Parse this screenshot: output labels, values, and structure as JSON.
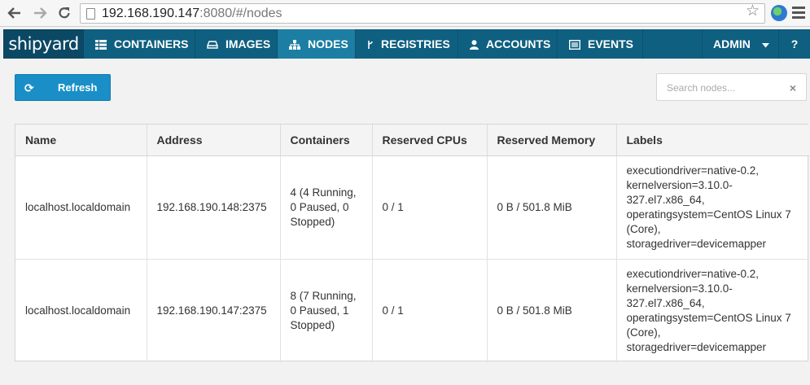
{
  "browser": {
    "url_host": "192.168.190.147",
    "url_rest": ":8080/#/nodes"
  },
  "nav": {
    "brand": "shipyard",
    "items": [
      {
        "label": "CONTAINERS",
        "icon": "grid-icon"
      },
      {
        "label": "IMAGES",
        "icon": "drive-icon"
      },
      {
        "label": "NODES",
        "icon": "sitemap-icon"
      },
      {
        "label": "REGISTRIES",
        "icon": "code-fork-icon"
      },
      {
        "label": "ACCOUNTS",
        "icon": "user-icon"
      },
      {
        "label": "EVENTS",
        "icon": "list-icon"
      }
    ],
    "active": "NODES",
    "user": "ADMIN",
    "help": "?"
  },
  "toolbar": {
    "refresh_label": "Refresh",
    "search_placeholder": "Search nodes..."
  },
  "table": {
    "headers": [
      "Name",
      "Address",
      "Containers",
      "Reserved CPUs",
      "Reserved Memory",
      "Labels"
    ],
    "rows": [
      {
        "name": "localhost.localdomain",
        "address": "192.168.190.148:2375",
        "containers": "4 (4 Running, 0 Paused, 0 Stopped)",
        "cpus": "0 / 1",
        "memory": "0 B / 501.8 MiB",
        "labels": "executiondriver=native-0.2, kernelversion=3.10.0-327.el7.x86_64, operatingsystem=CentOS Linux 7 (Core), storagedriver=devicemapper"
      },
      {
        "name": "localhost.localdomain",
        "address": "192.168.190.147:2375",
        "containers": "8 (7 Running, 0 Paused, 1 Stopped)",
        "cpus": "0 / 1",
        "memory": "0 B / 501.8 MiB",
        "labels": "executiondriver=native-0.2, kernelversion=3.10.0-327.el7.x86_64, operatingsystem=CentOS Linux 7 (Core), storagedriver=devicemapper"
      }
    ]
  }
}
